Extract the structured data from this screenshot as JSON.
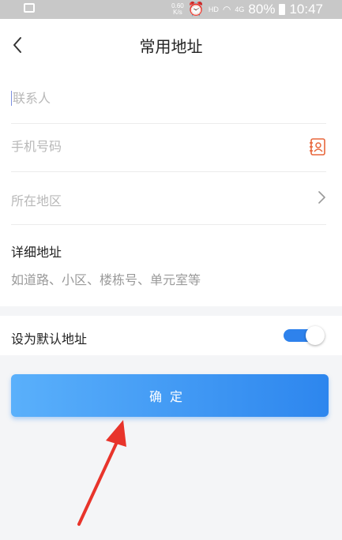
{
  "statusbar": {
    "speed_value": "0.60",
    "speed_unit": "K/s",
    "hd": "HD",
    "network": "4G",
    "battery": "80%",
    "time": "10:47"
  },
  "header": {
    "title": "常用地址"
  },
  "form": {
    "contact_placeholder": "联系人",
    "phone_placeholder": "手机号码",
    "region_placeholder": "所在地区",
    "detail_label": "详细地址",
    "detail_placeholder": "如道路、小区、楼栋号、单元室等"
  },
  "default_address": {
    "label": "设为默认地址",
    "enabled": true
  },
  "confirm_label": "确定",
  "colors": {
    "accent": "#2e82ec",
    "annotation_arrow": "#e8342b"
  }
}
